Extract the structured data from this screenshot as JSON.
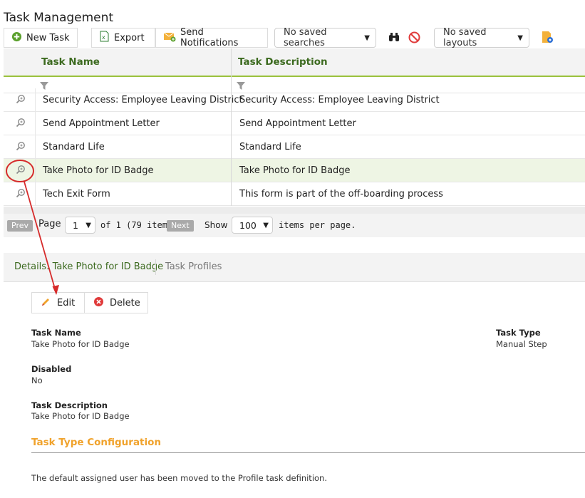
{
  "page": {
    "title": "Task Management"
  },
  "toolbar": {
    "new_task": "New Task",
    "export": "Export",
    "send_notifications": "Send Notifications",
    "saved_searches": "No saved searches",
    "saved_layouts": "No saved layouts"
  },
  "grid": {
    "columns": [
      "Task Name",
      "Task Description"
    ],
    "rows": [
      {
        "name": "Security Access: Employee Leaving District",
        "description": "Security Access: Employee Leaving District"
      },
      {
        "name": "Send Appointment Letter",
        "description": "Send Appointment Letter"
      },
      {
        "name": "Standard Life",
        "description": "Standard Life"
      },
      {
        "name": "Take Photo for ID Badge",
        "description": "Take Photo for ID Badge",
        "selected": true
      },
      {
        "name": "Tech Exit Form",
        "description": "This form is part of the off-boarding process"
      }
    ]
  },
  "pager": {
    "prev": "Prev",
    "page_label": "Page",
    "page_value": "1",
    "of_text": "of 1 (79 items)",
    "next": "Next",
    "show_label": "Show",
    "show_value": "100",
    "items_per_page": "items per page."
  },
  "details": {
    "tab_active": "Details: Take Photo for ID Badge",
    "tab_profiles": "Task Profiles",
    "edit": "Edit",
    "delete": "Delete",
    "fields": {
      "task_name_label": "Task Name",
      "task_name_value": "Take Photo for ID Badge",
      "task_type_label": "Task Type",
      "task_type_value": "Manual Step",
      "disabled_label": "Disabled",
      "disabled_value": "No",
      "task_desc_label": "Task Description",
      "task_desc_value": "Take Photo for ID Badge"
    },
    "section_title": "Task Type Configuration",
    "note": "The default assigned user has been moved to the Profile task definition."
  },
  "colors": {
    "accent_green": "#3c6a1f",
    "header_border": "#9ac13c",
    "section_orange": "#f0a22b",
    "annotation_red": "#d62a2a"
  },
  "icons": [
    "plus-circle-icon",
    "excel-icon",
    "mail-icon",
    "binoculars-icon",
    "no-entry-icon",
    "layout-settings-icon",
    "filter-icon",
    "magnify-icon",
    "pencil-icon",
    "delete-x-icon"
  ]
}
